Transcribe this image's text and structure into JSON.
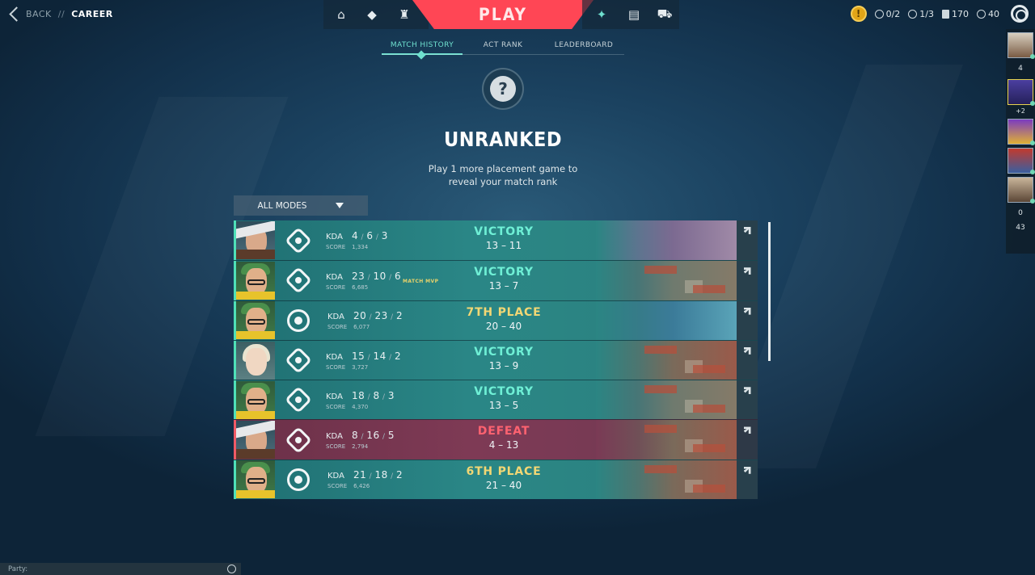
{
  "topbar": {
    "back_label": "BACK",
    "separator": "//",
    "breadcrumb": "CAREER",
    "play_label": "PLAY",
    "nav_icons_left": [
      "home-icon",
      "collection-icon",
      "agents-icon"
    ],
    "nav_icons_right": [
      "career-icon",
      "battlepass-icon",
      "store-icon"
    ],
    "currency": {
      "matches": "0/2",
      "plus": "1/3",
      "valorant_points": "170",
      "radianite": "40"
    }
  },
  "social": {
    "count_top": "4",
    "party_extra": "+2",
    "count_a": "0",
    "count_b": "43"
  },
  "career": {
    "tabs": [
      "MATCH HISTORY",
      "ACT RANK",
      "LEADERBOARD"
    ],
    "active_tab": "MATCH HISTORY",
    "rank_badge_glyph": "?",
    "rank_title": "UNRANKED",
    "rank_desc_line1": "Play 1 more placement game to",
    "rank_desc_line2": "reveal your match rank",
    "mode_filter": "ALL MODES"
  },
  "match_labels": {
    "kda": "KDA",
    "score": "SCORE",
    "mvp": "MATCH MVP"
  },
  "matches": [
    {
      "agent": "chamber",
      "mode": "unrated",
      "kda": [
        "4",
        "6",
        "3"
      ],
      "score": "1,334",
      "result": "VICTORY",
      "rounds": "13 – 11",
      "outcome": "win",
      "map": "ascent",
      "mvp": false
    },
    {
      "agent": "killjoy",
      "mode": "unrated",
      "kda": [
        "23",
        "10",
        "6"
      ],
      "score": "6,685",
      "result": "VICTORY",
      "rounds": "13 – 7",
      "outcome": "win",
      "map": "ascent2",
      "mvp": true
    },
    {
      "agent": "killjoy",
      "mode": "deathmatch",
      "kda": [
        "20",
        "23",
        "2"
      ],
      "score": "6,077",
      "result": "7TH PLACE",
      "rounds": "20 – 40",
      "outcome": "place",
      "map": "icebox",
      "mvp": false
    },
    {
      "agent": "sage",
      "mode": "unrated",
      "kda": [
        "15",
        "14",
        "2"
      ],
      "score": "3,727",
      "result": "VICTORY",
      "rounds": "13 – 9",
      "outcome": "win",
      "map": "split",
      "mvp": false
    },
    {
      "agent": "killjoy",
      "mode": "unrated",
      "kda": [
        "18",
        "8",
        "3"
      ],
      "score": "4,370",
      "result": "VICTORY",
      "rounds": "13 – 5",
      "outcome": "win",
      "map": "ascent2",
      "mvp": false
    },
    {
      "agent": "chamber",
      "mode": "unrated",
      "kda": [
        "8",
        "16",
        "5"
      ],
      "score": "2,794",
      "result": "DEFEAT",
      "rounds": "4 – 13",
      "outcome": "loss",
      "map": "split-loss",
      "mvp": false
    },
    {
      "agent": "killjoy",
      "mode": "deathmatch",
      "kda": [
        "21",
        "18",
        "2"
      ],
      "score": "6,426",
      "result": "6TH PLACE",
      "rounds": "21 – 40",
      "outcome": "place",
      "map": "split",
      "mvp": false
    }
  ],
  "party_label": "Party:",
  "colors": {
    "accent": "#ff4655",
    "teal": "#6ff0d6",
    "gold": "#f2d774",
    "defeat": "#ff6270"
  }
}
